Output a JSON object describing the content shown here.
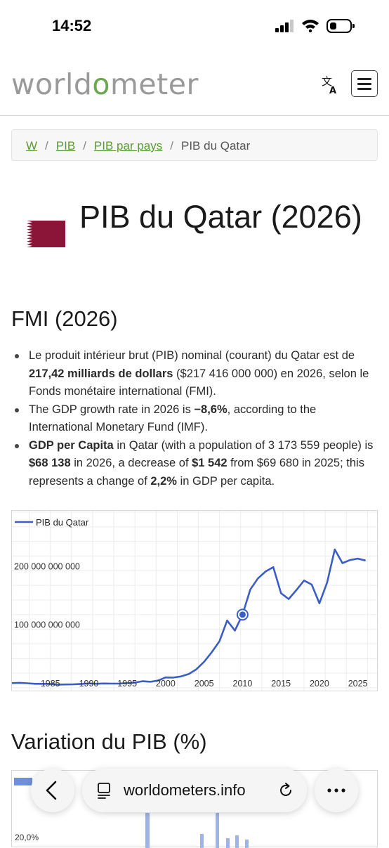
{
  "status_bar": {
    "time": "14:52"
  },
  "header": {
    "logo_pre": "world",
    "logo_o": "o",
    "logo_post": "meter"
  },
  "breadcrumb": {
    "items": [
      "W",
      "PIB",
      "PIB par pays"
    ],
    "current": "PIB du Qatar"
  },
  "page": {
    "title": "PIB du Qatar (2026)"
  },
  "imf_section": {
    "title": "FMI (2026)",
    "bullet1": {
      "t1": "Le produit intérieur brut (PIB) nominal (courant) du Qatar est de ",
      "b1": "217,42 milliards de dollars",
      "t2": " ($217 416 000 000) en 2026, selon le Fonds monétaire international (FMI)."
    },
    "bullet2": {
      "t1": "The GDP growth rate in 2026 is ",
      "b1": "−8,6%",
      "t2": ", according to the International Monetary Fund (IMF)."
    },
    "bullet3": {
      "b1": "GDP per Capita",
      "t1": " in Qatar (with a population of 3 173 559 people) is ",
      "b2": "$68 138",
      "t2": " in 2026, a decrease of ",
      "b3": "$1 542",
      "t3": " from $69 680 in 2025; this represents a change of ",
      "b4": "2,2%",
      "t4": " in GDP per capita."
    }
  },
  "chart_data": {
    "type": "line",
    "legend": "PIB du Qatar",
    "series": [
      {
        "name": "PIB du Qatar",
        "x": [
          1980,
          1981,
          1982,
          1983,
          1984,
          1985,
          1986,
          1987,
          1988,
          1989,
          1990,
          1991,
          1992,
          1993,
          1994,
          1995,
          1996,
          1997,
          1998,
          1999,
          2000,
          2001,
          2002,
          2003,
          2004,
          2005,
          2006,
          2007,
          2008,
          2009,
          2010,
          2011,
          2012,
          2013,
          2014,
          2015,
          2016,
          2017,
          2018,
          2019,
          2020,
          2021,
          2022,
          2023,
          2024,
          2025,
          2026
        ],
        "y": [
          8000000000,
          8500000000,
          7800000000,
          6800000000,
          6900000000,
          6700000000,
          5500000000,
          5800000000,
          6000000000,
          6700000000,
          7500000000,
          7000000000,
          7500000000,
          7200000000,
          7300000000,
          8100000000,
          9000000000,
          11300000000,
          10300000000,
          12400000000,
          17800000000,
          17500000000,
          19400000000,
          23500000000,
          31700000000,
          44500000000,
          60900000000,
          79700000000,
          115000000000,
          97800000000,
          125000000000,
          167800000000,
          186800000000,
          198700000000,
          206200000000,
          161700000000,
          151700000000,
          166900000000,
          183300000000,
          176400000000,
          144400000000,
          179700000000,
          236300000000,
          213000000000,
          218300000000,
          220700000000,
          217400000000
        ]
      }
    ],
    "x_ticks": [
      "1985",
      "1990",
      "1995",
      "2000",
      "2005",
      "2010",
      "2015",
      "2020",
      "2025"
    ],
    "y_ticks": [
      "100 000 000 000",
      "200 000 000 000"
    ],
    "highlight": {
      "x": 2010,
      "y": 125000000000
    },
    "xlim": [
      1980,
      2027.5
    ],
    "ylim": [
      0,
      300000000000
    ],
    "grid": true,
    "legend_position": "top-left"
  },
  "variation_section": {
    "title": "Variation du PIB (%)",
    "first_tick": "20,0%"
  },
  "browser": {
    "url": "worldometers.info"
  },
  "colors": {
    "accent": "#6aa84f",
    "line": "#3b5ec6",
    "link": "#5b9b32",
    "flag": "#8a1538"
  }
}
